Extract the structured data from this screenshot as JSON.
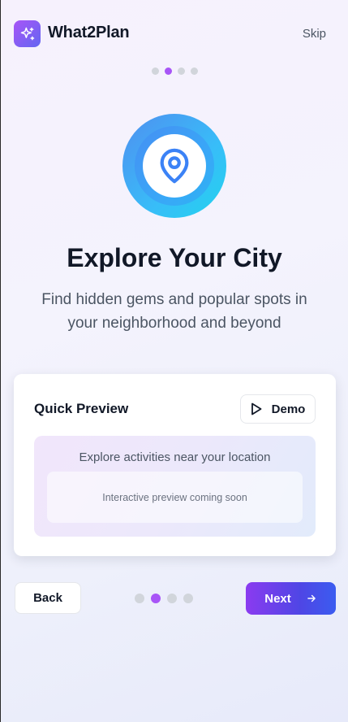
{
  "header": {
    "app_name": "What2Plan",
    "skip_label": "Skip",
    "logo_icon": "sparkles-icon"
  },
  "progress": {
    "total_steps": 4,
    "current_step": 2
  },
  "hero": {
    "icon": "map-pin-icon",
    "title": "Explore Your City",
    "subtitle": "Find hidden gems and popular spots in your neighborhood and beyond"
  },
  "preview_card": {
    "title": "Quick Preview",
    "demo_label": "Demo",
    "demo_icon": "play-icon",
    "preview_label": "Explore activities near your location",
    "preview_placeholder": "Interactive preview coming soon"
  },
  "footer": {
    "back_label": "Back",
    "next_label": "Next",
    "next_icon": "arrow-right-icon"
  },
  "colors": {
    "accent_purple": "#a855f7",
    "accent_blue": "#3b82f6",
    "dot_inactive": "#d1d5db"
  }
}
